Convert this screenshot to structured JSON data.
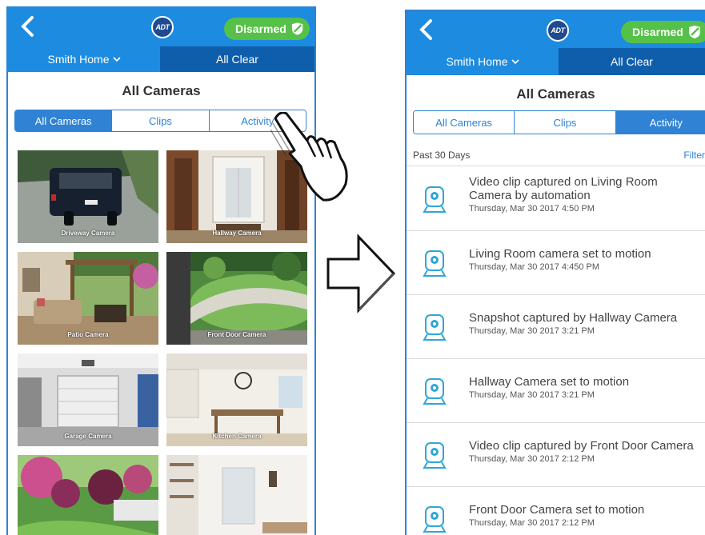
{
  "app": {
    "logo": "ADT",
    "status_label": "Disarmed",
    "home_label": "Smith Home",
    "system_status": "All Clear",
    "page_title": "All Cameras"
  },
  "tabs": [
    "All Cameras",
    "Clips",
    "Activity"
  ],
  "cameras": [
    {
      "label": "Driveway Camera",
      "scene": "driveway"
    },
    {
      "label": "Hallway Camera",
      "scene": "hallway"
    },
    {
      "label": "Patio Camera",
      "scene": "patio"
    },
    {
      "label": "Front Door Camera",
      "scene": "frontdoor"
    },
    {
      "label": "Garage Camera",
      "scene": "garage"
    },
    {
      "label": "Kitchen Camera",
      "scene": "kitchen"
    },
    {
      "label": "",
      "scene": "garden"
    },
    {
      "label": "",
      "scene": "living"
    }
  ],
  "activity": {
    "period": "Past 30 Days",
    "filter_label": "Filter",
    "items": [
      {
        "lines": [
          "Video clip captured on Living Room",
          "Camera by automation"
        ],
        "time": "Thursday, Mar 30 2017 4:50 PM"
      },
      {
        "lines": [
          "Living Room camera set to motion"
        ],
        "time": "Thursday, Mar 30 2017 4:450 PM"
      },
      {
        "lines": [
          "Snapshot captured by Hallway Camera"
        ],
        "time": "Thursday, Mar 30 2017 3:21 PM"
      },
      {
        "lines": [
          "Hallway Camera set to motion"
        ],
        "time": "Thursday, Mar 30 2017 3:21 PM"
      },
      {
        "lines": [
          "Video clip captured by Front Door Camera"
        ],
        "time": "Thursday, Mar 30 2017 2:12 PM"
      },
      {
        "lines": [
          "Front Door Camera set to motion"
        ],
        "time": "Thursday, Mar 30 2017 2:12 PM"
      }
    ]
  },
  "colors": {
    "primary": "#1d8bdf",
    "primary_dark": "#0f5eab",
    "accent_green": "#56c149",
    "border_blue": "#2f82d4"
  },
  "icons": {
    "back": "chevron-left-icon",
    "shield": "shield-icon",
    "dropdown": "chevron-down-icon",
    "camera": "camera-icon",
    "hand": "pointing-hand-icon",
    "transition": "right-arrow-icon"
  }
}
